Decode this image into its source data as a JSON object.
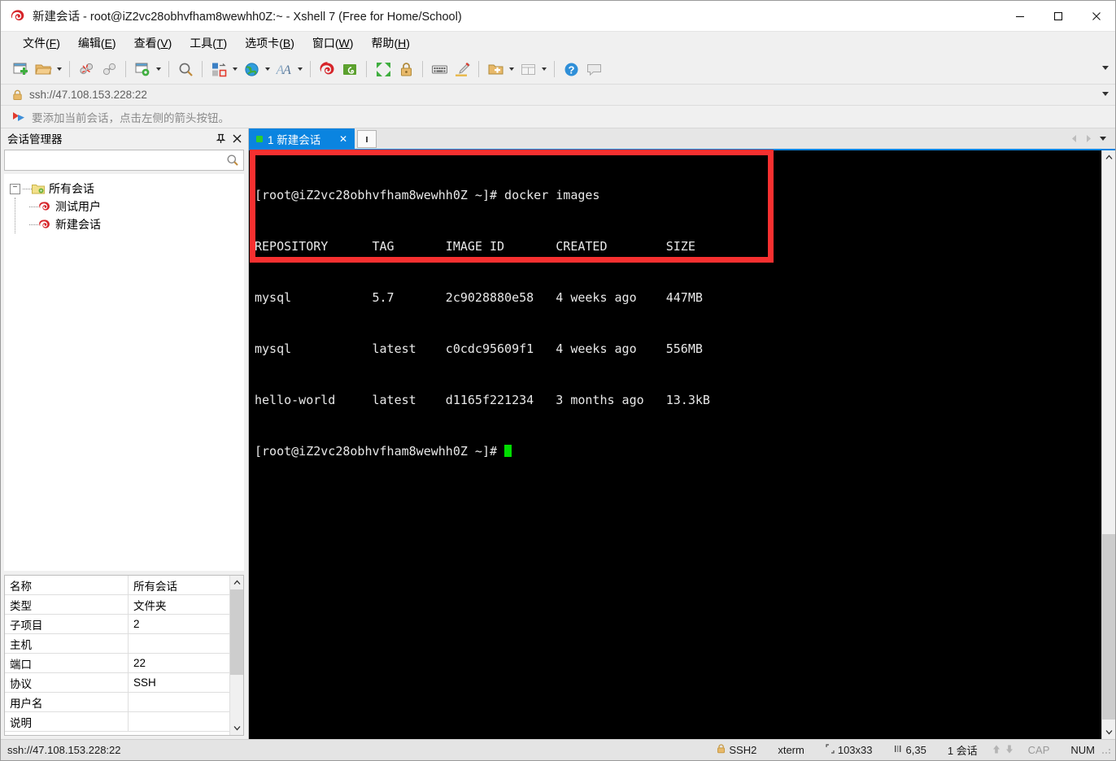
{
  "window": {
    "title": "新建会话 - root@iZ2vc28obhvfham8wewhh0Z:~ - Xshell 7 (Free for Home/School)",
    "app_icon": "xshell-spiral-icon",
    "minimize_label": "—",
    "maximize_label": "□",
    "close_label": "✕"
  },
  "menu": {
    "items": [
      {
        "label": "文件",
        "accel": "F"
      },
      {
        "label": "编辑",
        "accel": "E"
      },
      {
        "label": "查看",
        "accel": "V"
      },
      {
        "label": "工具",
        "accel": "T"
      },
      {
        "label": "选项卡",
        "accel": "B"
      },
      {
        "label": "窗口",
        "accel": "W"
      },
      {
        "label": "帮助",
        "accel": "H"
      }
    ]
  },
  "toolbar": {
    "buttons": [
      {
        "name": "new-session-icon",
        "dropdown": false
      },
      {
        "name": "open-session-icon",
        "dropdown": true
      },
      {
        "sep": true
      },
      {
        "name": "disconnect-icon",
        "dropdown": false
      },
      {
        "name": "reconnect-icon",
        "dropdown": false
      },
      {
        "sep": true
      },
      {
        "name": "session-properties-icon",
        "dropdown": true
      },
      {
        "sep": true
      },
      {
        "name": "find-icon",
        "dropdown": false
      },
      {
        "sep": true
      },
      {
        "name": "transfer-file-icon",
        "dropdown": true
      },
      {
        "name": "globe-icon",
        "dropdown": true
      },
      {
        "name": "font-icon",
        "dropdown": true
      },
      {
        "sep": true
      },
      {
        "name": "xshell-icon",
        "dropdown": false
      },
      {
        "name": "xftp-icon",
        "dropdown": false
      },
      {
        "sep": true
      },
      {
        "name": "fullscreen-icon",
        "dropdown": false
      },
      {
        "name": "lock-icon",
        "dropdown": false
      },
      {
        "sep": true
      },
      {
        "name": "keyboard-icon",
        "dropdown": false
      },
      {
        "name": "highlight-pen-icon",
        "dropdown": false
      },
      {
        "sep": true
      },
      {
        "name": "new-folder-icon",
        "dropdown": true
      },
      {
        "name": "layout-icon",
        "dropdown": true
      },
      {
        "sep": true
      },
      {
        "name": "help-icon",
        "dropdown": false
      },
      {
        "name": "chat-icon",
        "dropdown": false
      }
    ]
  },
  "address_bar": {
    "lock_icon": "lock-icon",
    "url": "ssh://47.108.153.228:22"
  },
  "hint_bar": {
    "icon": "add-bookmark-arrow-icon",
    "text": "要添加当前会话，点击左侧的箭头按钮。"
  },
  "session_manager": {
    "title": "会话管理器",
    "pin_label": "⊓",
    "close_label": "✕",
    "search": {
      "value": "",
      "placeholder": "",
      "icon": "search-icon"
    },
    "tree": {
      "root": {
        "label": "所有会话",
        "icon": "folder-sessions-icon",
        "expanded": true,
        "toggle": "−"
      },
      "children": [
        {
          "label": "测试用户",
          "icon": "session-icon"
        },
        {
          "label": "新建会话",
          "icon": "session-icon"
        }
      ]
    },
    "properties": [
      {
        "key": "名称",
        "value": "所有会话"
      },
      {
        "key": "类型",
        "value": "文件夹"
      },
      {
        "key": "子项目",
        "value": "2"
      },
      {
        "key": "主机",
        "value": ""
      },
      {
        "key": "端口",
        "value": "22"
      },
      {
        "key": "协议",
        "value": "SSH"
      },
      {
        "key": "用户名",
        "value": ""
      },
      {
        "key": "说明",
        "value": ""
      }
    ]
  },
  "tabs": {
    "items": [
      {
        "label": "1 新建会话",
        "active": true,
        "close_label": "✕",
        "status_color": "#2ecc2e"
      }
    ],
    "add_label": "",
    "nav_prev": "◀",
    "nav_next": "▶"
  },
  "terminal": {
    "lines": [
      "[root@iZ2vc28obhvfham8wewhh0Z ~]# docker images",
      "REPOSITORY      TAG       IMAGE ID       CREATED        SIZE",
      "mysql           5.7       2c9028880e58   4 weeks ago    447MB",
      "mysql           latest    c0cdc95609f1   4 weeks ago    556MB",
      "hello-world     latest    d1165f221234   3 months ago   13.3kB"
    ],
    "prompt": "[root@iZ2vc28obhvfham8wewhh0Z ~]# ",
    "cursor_color": "#00dd00",
    "background": "#000000",
    "foreground": "#e8e8e8"
  },
  "annotation": {
    "type": "rectangle-highlight",
    "color": "#f73030"
  },
  "status_bar": {
    "url": "ssh://47.108.153.228:22",
    "protocol": "SSH2",
    "protocol_icon": "lock-icon",
    "term_type": "xterm",
    "size_icon": "screen-size-icon",
    "size": "103x33",
    "cursor_icon": "cursor-pos-icon",
    "cursor_pos": "6,35",
    "sessions": "1 会话",
    "up_arrow": "⬆",
    "down_arrow": "⬇",
    "caps": "CAP",
    "num": "NUM"
  }
}
